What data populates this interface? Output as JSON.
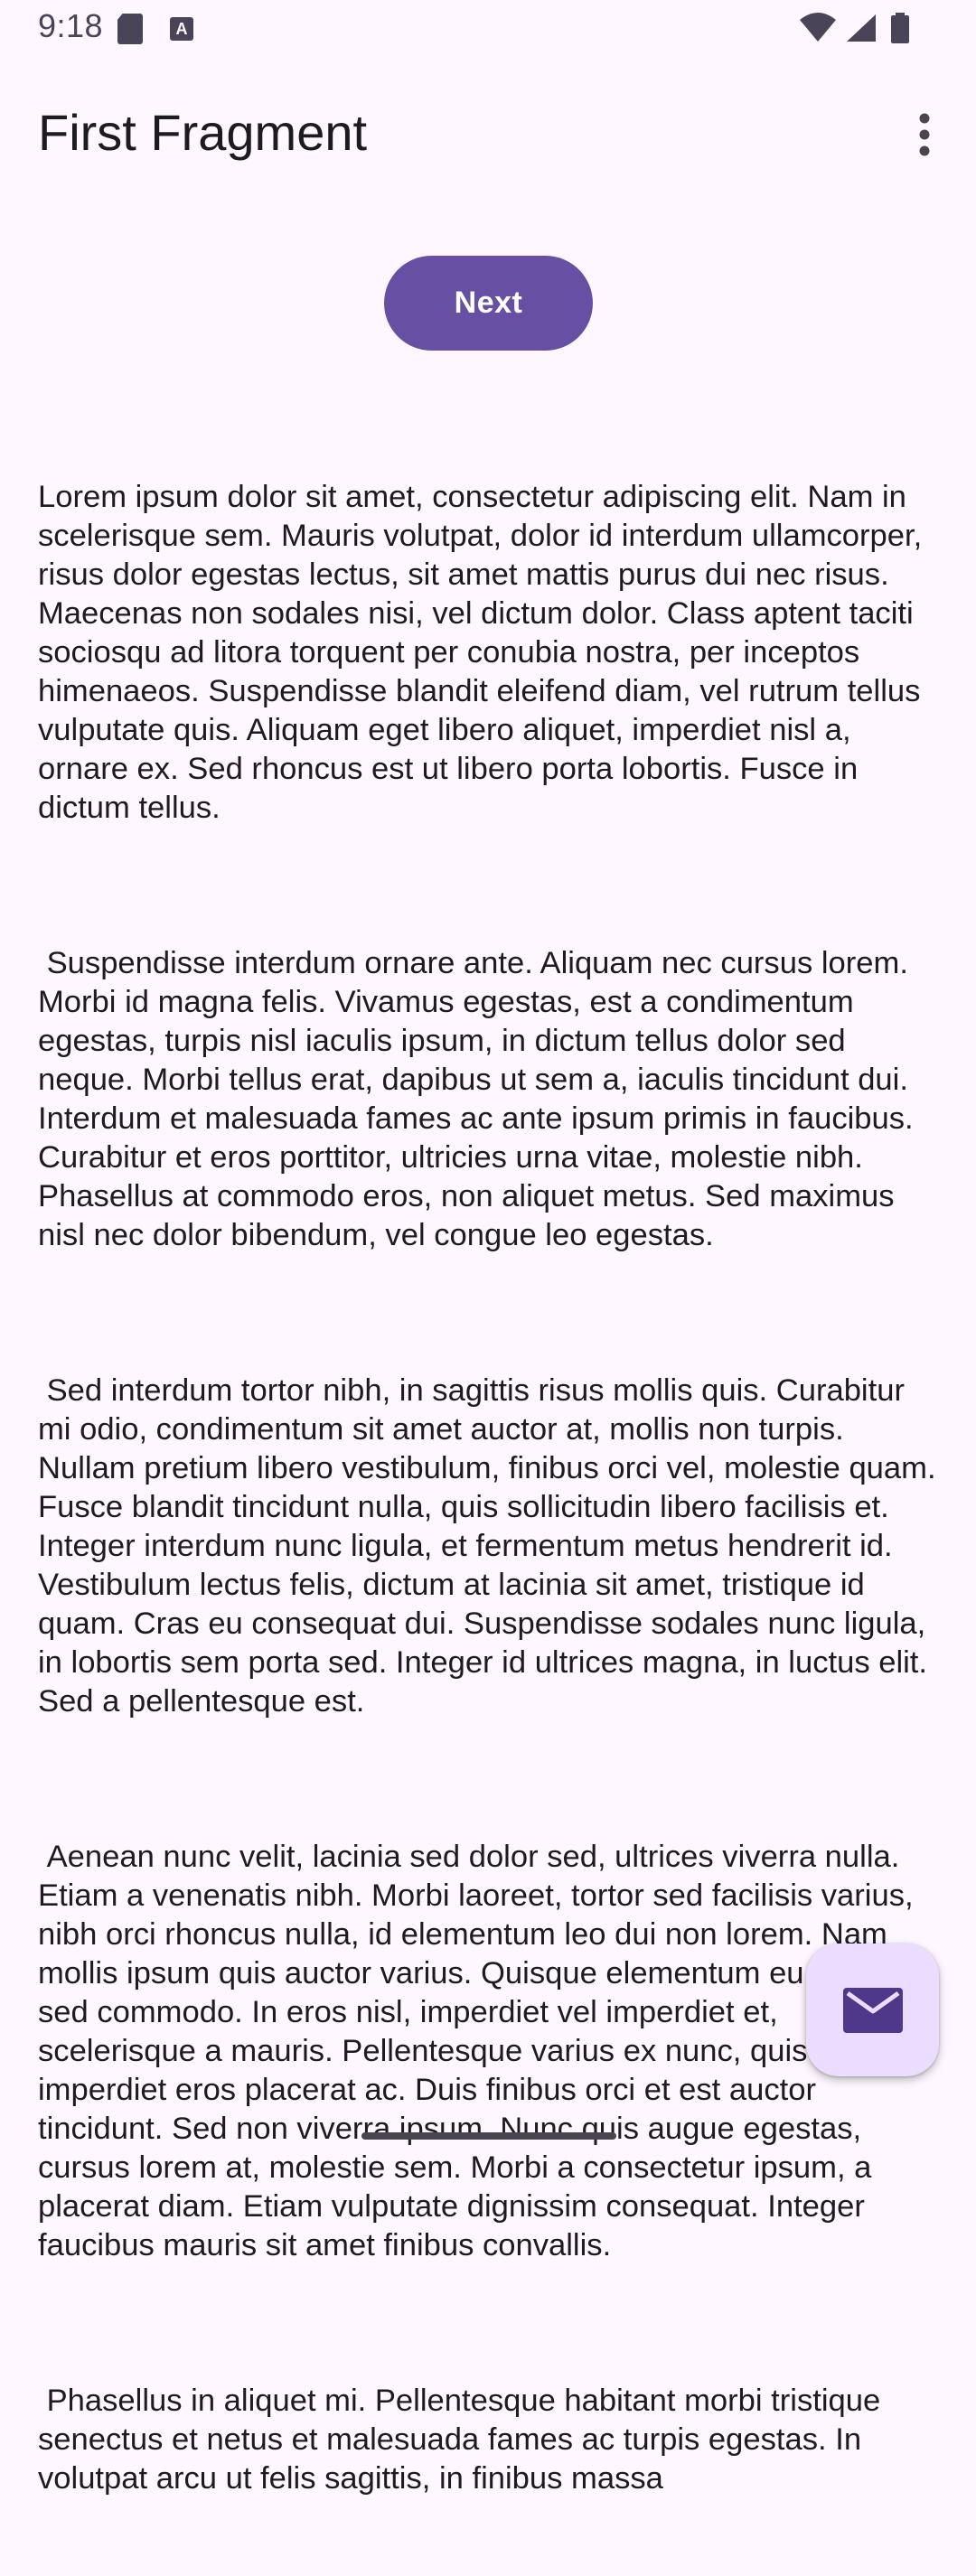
{
  "status_bar": {
    "time": "9:18",
    "a_icon_label": "A",
    "icons": [
      "sd-card-icon",
      "a-icon",
      "wifi-icon",
      "signal-icon",
      "battery-icon"
    ]
  },
  "app_bar": {
    "title": "First Fragment",
    "overflow_icon": "more-vert-icon"
  },
  "next_button": {
    "label": "Next"
  },
  "paragraphs": [
    "Lorem ipsum dolor sit amet, consectetur adipiscing elit. Nam in scelerisque sem. Mauris volutpat, dolor id interdum ullamcorper, risus dolor egestas lectus, sit amet mattis purus dui nec risus. Maecenas non sodales nisi, vel dictum dolor. Class aptent taciti sociosqu ad litora torquent per conubia nostra, per inceptos himenaeos. Suspendisse blandit eleifend diam, vel rutrum tellus vulputate quis. Aliquam eget libero aliquet, imperdiet nisl a, ornare ex. Sed rhoncus est ut libero porta lobortis. Fusce in dictum tellus.",
    " Suspendisse interdum ornare ante. Aliquam nec cursus lorem. Morbi id magna felis. Vivamus egestas, est a condimentum egestas, turpis nisl iaculis ipsum, in dictum tellus dolor sed neque. Morbi tellus erat, dapibus ut sem a, iaculis tincidunt dui. Interdum et malesuada fames ac ante ipsum primis in faucibus. Curabitur et eros porttitor, ultricies urna vitae, molestie nibh. Phasellus at commodo eros, non aliquet metus. Sed maximus nisl nec dolor bibendum, vel congue leo egestas.",
    " Sed interdum tortor nibh, in sagittis risus mollis quis. Curabitur mi odio, condimentum sit amet auctor at, mollis non turpis. Nullam pretium libero vestibulum, finibus orci vel, molestie quam. Fusce blandit tincidunt nulla, quis sollicitudin libero facilisis et. Integer interdum nunc ligula, et fermentum metus hendrerit id. Vestibulum lectus felis, dictum at lacinia sit amet, tristique id quam. Cras eu consequat dui. Suspendisse sodales nunc ligula, in lobortis sem porta sed. Integer id ultrices magna, in luctus elit. Sed a pellentesque est.",
    " Aenean nunc velit, lacinia sed dolor sed, ultrices viverra nulla. Etiam a venenatis nibh. Morbi laoreet, tortor sed facilisis varius, nibh orci rhoncus nulla, id elementum leo dui non lorem. Nam mollis ipsum quis auctor varius. Quisque elementum eu libero sed commodo. In eros nisl, imperdiet vel imperdiet et, scelerisque a mauris. Pellentesque varius ex nunc, quis imperdiet eros placerat ac. Duis finibus orci et est auctor tincidunt. Sed non viverra ipsum. Nunc quis augue egestas, cursus lorem at, molestie sem. Morbi a consectetur ipsum, a placerat diam. Etiam vulputate dignissim consequat. Integer faucibus mauris sit amet finibus convallis.",
    " Phasellus in aliquet mi. Pellentesque habitant morbi tristique senectus et netus et malesuada fames ac turpis egestas. In volutpat arcu ut felis sagittis, in finibus massa"
  ],
  "fab": {
    "icon": "email-icon"
  },
  "colors": {
    "background": "#fef7ff",
    "primary": "#6750a4",
    "fab_container": "#eaddff",
    "on_surface": "#1d1b20"
  }
}
